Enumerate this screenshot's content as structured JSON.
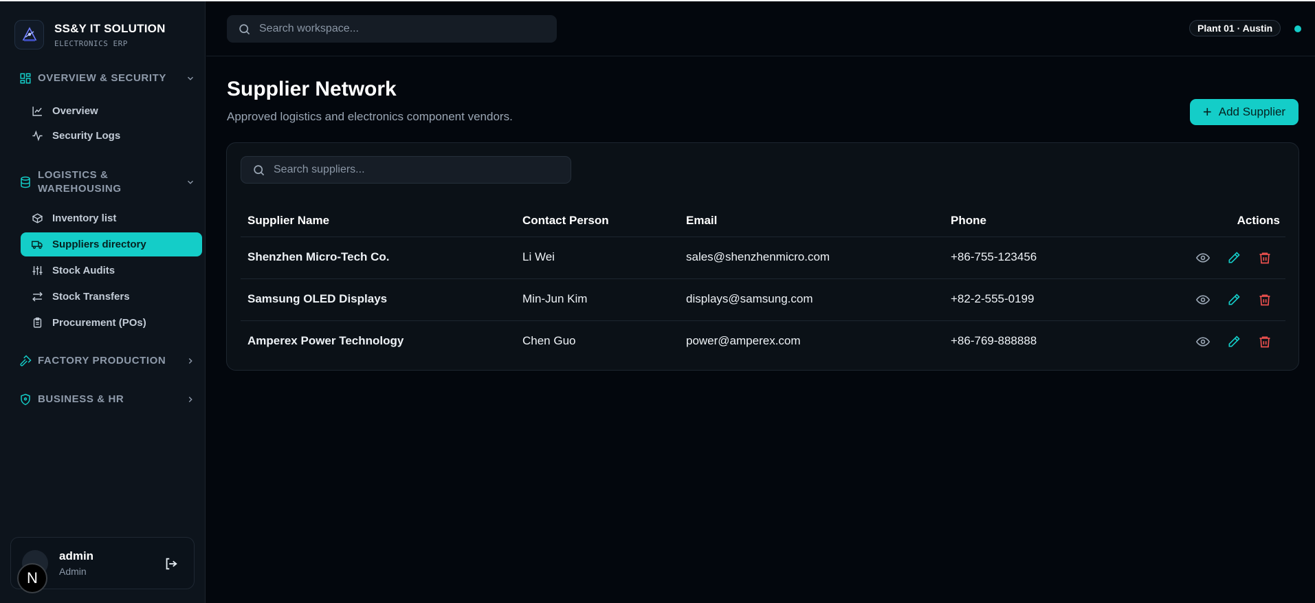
{
  "brand": {
    "title": "SS&Y IT SOLUTION",
    "subtitle": "ELECTRONICS ERP"
  },
  "sidebar": {
    "sections": [
      {
        "label": "OVERVIEW & SECURITY",
        "items": [
          {
            "label": "Overview"
          },
          {
            "label": "Security Logs"
          }
        ]
      },
      {
        "label_line1": "LOGISTICS &",
        "label_line2": "WAREHOUSING",
        "items": [
          {
            "label": "Inventory list"
          },
          {
            "label": "Suppliers directory",
            "active": true
          },
          {
            "label": "Stock Audits"
          },
          {
            "label": "Stock Transfers"
          },
          {
            "label": "Procurement (POs)"
          }
        ]
      },
      {
        "label": "FACTORY PRODUCTION"
      },
      {
        "label": "BUSINESS & HR"
      }
    ]
  },
  "user": {
    "name": "admin",
    "role": "Admin",
    "badge": "N"
  },
  "topbar": {
    "search_placeholder": "Search workspace...",
    "plant": "Plant 01 · Austin"
  },
  "page": {
    "title": "Supplier Network",
    "subtitle": "Approved logistics and electronics component vendors.",
    "add_button": "Add Supplier"
  },
  "table": {
    "search_placeholder": "Search suppliers...",
    "columns": [
      "Supplier Name",
      "Contact Person",
      "Email",
      "Phone",
      "Actions"
    ],
    "rows": [
      {
        "name": "Shenzhen Micro-Tech Co.",
        "contact": "Li Wei",
        "email": "sales@shenzhenmicro.com",
        "phone": "+86-755-123456"
      },
      {
        "name": "Samsung OLED Displays",
        "contact": "Min-Jun Kim",
        "email": "displays@samsung.com",
        "phone": "+82-2-555-0199"
      },
      {
        "name": "Amperex Power Technology",
        "contact": "Chen Guo",
        "email": "power@amperex.com",
        "phone": "+86-769-888888"
      }
    ]
  },
  "colors": {
    "accent": "#14cdc8",
    "danger": "#f0514f",
    "background": "#03070d",
    "sidebar": "#0d141c"
  }
}
